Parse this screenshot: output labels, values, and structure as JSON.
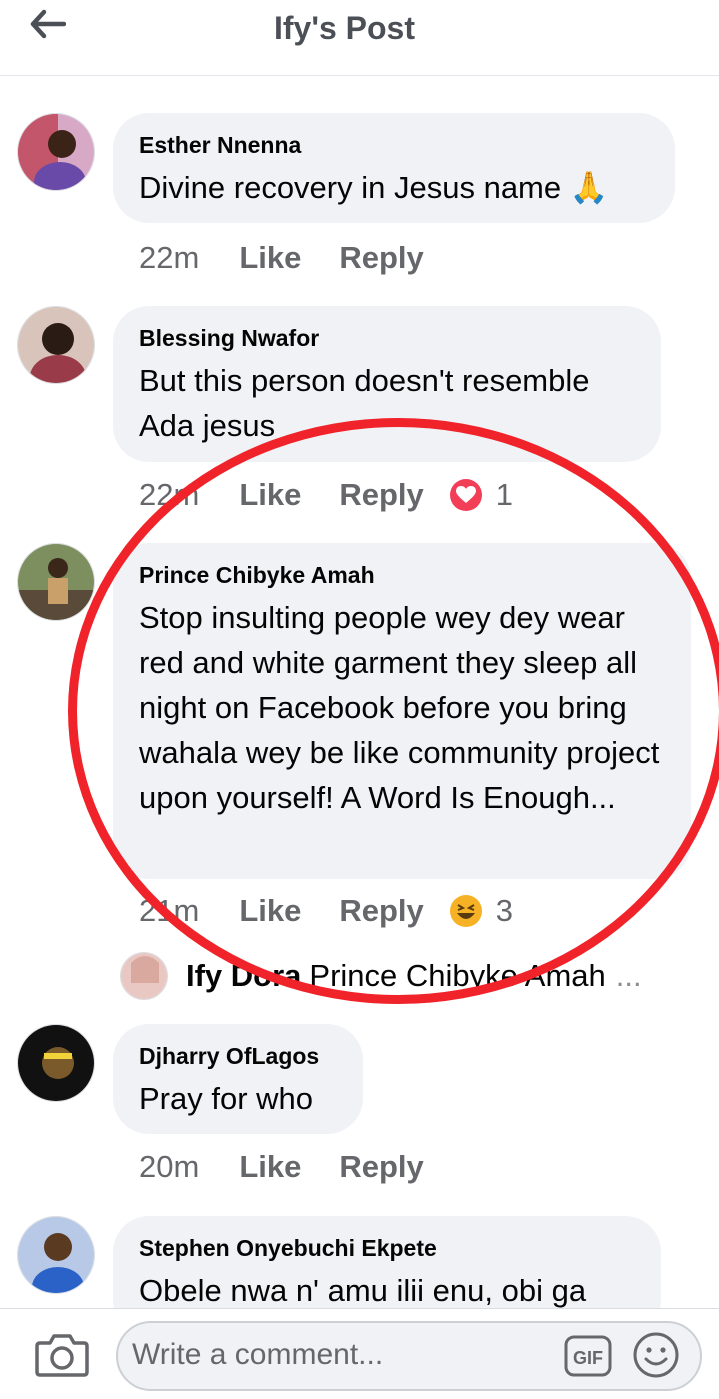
{
  "header": {
    "title": "Ify's Post",
    "back_icon": "arrow-left-icon"
  },
  "comments": [
    {
      "author": "Esther Nnenna",
      "text": "Divine recovery in Jesus name 🙏",
      "time": "22m",
      "like": "Like",
      "reply": "Reply"
    },
    {
      "author": "Blessing Nwafor",
      "text": "But this person doesn't resemble Ada jesus",
      "time": "22m",
      "like": "Like",
      "reply": "Reply",
      "reaction_icon": "love-reaction-icon",
      "reaction_count": "1"
    },
    {
      "author": "Prince Chibyke Amah",
      "text": "Stop insulting people wey dey wear red and white garment they sleep all night on Facebook before you bring wahala wey be like community project upon yourself! A Word Is Enough...",
      "time": "21m",
      "like": "Like",
      "reply": "Reply",
      "reaction_icon": "haha-reaction-icon",
      "reaction_count": "3",
      "reply_preview": {
        "author": "Ify Dora",
        "text": "Prince Chibyke Amah",
        "more": "..."
      }
    },
    {
      "author": "Djharry OfLagos",
      "text": "Pray for who",
      "time": "20m",
      "like": "Like",
      "reply": "Reply"
    },
    {
      "author": "Stephen Onyebuchi Ekpete",
      "text": "Obele nwa n' amu ilii enu, obi ga"
    }
  ],
  "composer": {
    "placeholder": "Write a comment...",
    "gif_label": "GIF",
    "camera_icon": "camera-icon",
    "emoji_icon": "emoji-icon"
  },
  "colors": {
    "bubble": "#f0f2f5",
    "meta_text": "#65676b",
    "annotation_circle": "#f0232a",
    "love_reaction": "#f33e58",
    "haha_reaction": "#f7b125"
  }
}
